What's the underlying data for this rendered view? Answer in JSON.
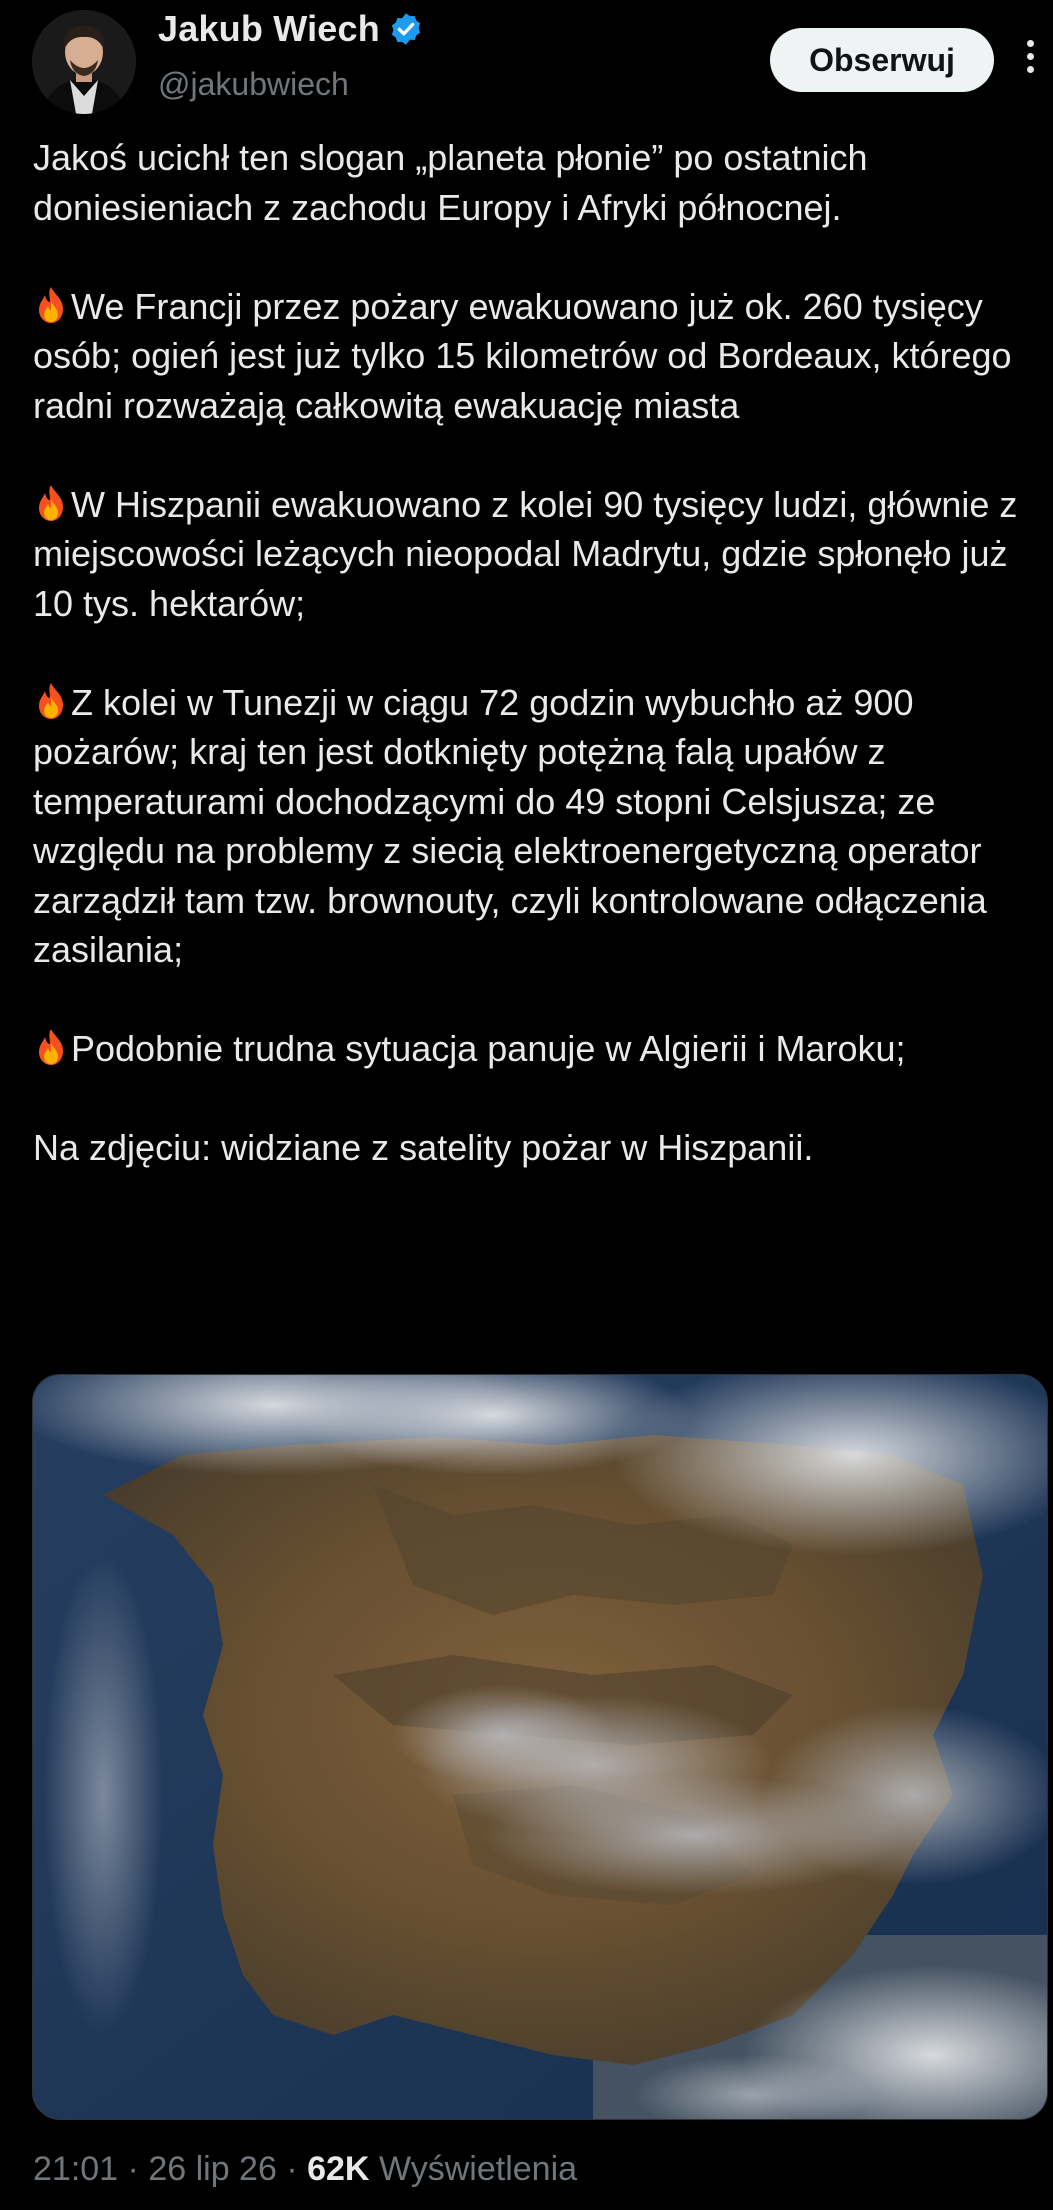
{
  "author": {
    "name": "Jakub Wiech",
    "handle": "@jakubwiech",
    "verified_color": "#1d9bf0"
  },
  "follow_button": {
    "label": "Obserwuj"
  },
  "more_icon": "more-vertical-icon",
  "tweet": {
    "paragraphs": [
      {
        "emoji": "",
        "text": "Jakoś ucichł ten slogan „planeta płonie” po ostatnich doniesieniach z zachodu Europy i Afryki północnej."
      },
      {
        "emoji": "fire-emoji",
        "text": "We Francji przez pożary ewakuowano już ok. 260 tysięcy osób; ogień jest już tylko 15 kilometrów od Bordeaux, którego radni rozważają całkowitą ewakuację miasta"
      },
      {
        "emoji": "fire-emoji",
        "text": "W Hiszpanii ewakuowano z kolei 90 tysięcy ludzi, głównie z miejscowości leżących nieopodal Madrytu, gdzie spłonęło już 10 tys. hektarów;"
      },
      {
        "emoji": "fire-emoji",
        "text": "Z kolei w Tunezji w ciągu 72 godzin wybuchło aż 900 pożarów; kraj ten jest dotknięty potężną falą upałów z temperaturami dochodzącymi do 49 stopni Celsjusza; ze względu na problemy z siecią elektroenergetyczną operator zarządził tam tzw. brownouty, czyli kontrolowane odłączenia zasilania;"
      },
      {
        "emoji": "fire-emoji",
        "text": "Podobnie trudna sytuacja panuje w Algierii i Maroku;"
      },
      {
        "emoji": "",
        "text": "Na zdjęciu: widziane z satelity pożar w Hiszpanii."
      }
    ]
  },
  "media": {
    "type": "satellite-image-iberian-peninsula"
  },
  "meta": {
    "time": "21:01",
    "separator": "·",
    "date": "26 lip 26",
    "views_count": "62K",
    "views_label": "Wyświetlenia"
  },
  "colors": {
    "background": "#000000",
    "text": "#e7e9ea",
    "secondary_text": "#71767b",
    "button_bg": "#eff3f4"
  }
}
